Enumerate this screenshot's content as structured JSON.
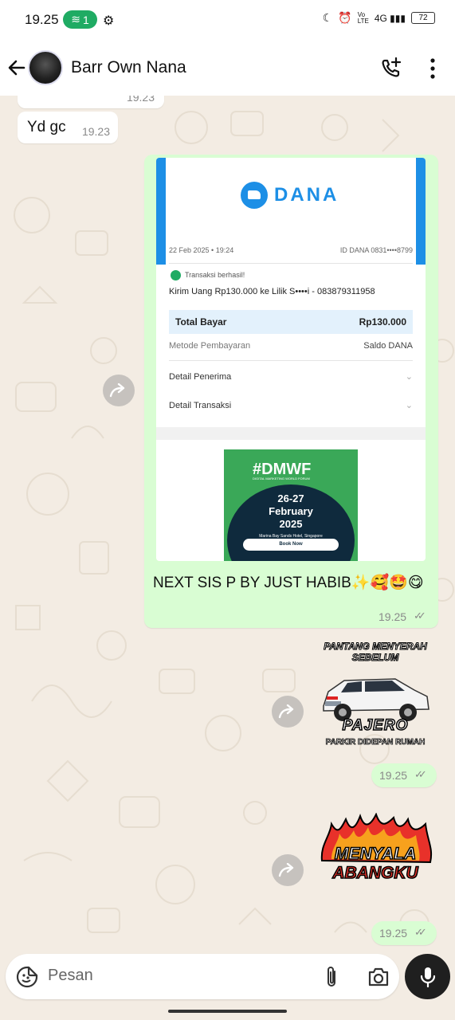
{
  "status_bar": {
    "time": "19.25",
    "hotspot_count": "1",
    "battery": "72"
  },
  "header": {
    "contact_name": "Barr Own Nana"
  },
  "messages": {
    "partial_time": "19.23",
    "incoming_text": "Yd gc",
    "incoming_time": "19.23",
    "receipt_caption": "NEXT SIS P BY JUST HABIB✨🥰🤩😋",
    "receipt_time": "19.25",
    "sticker1_time": "19.25",
    "sticker2_time": "19.25"
  },
  "receipt": {
    "brand": "DANA",
    "date": "22 Feb 2025 • 19:24",
    "id": "ID DANA 0831••••8799",
    "status": "Transaksi berhasil!",
    "description": "Kirim Uang Rp130.000 ke Lilik S••••i - 083879311958",
    "total_label": "Total Bayar",
    "total_value": "Rp130.000",
    "method_label": "Metode Pembayaran",
    "method_value": "Saldo DANA",
    "detail_recipient": "Detail Penerima",
    "detail_transaction": "Detail Transaksi"
  },
  "ad": {
    "title": "#DMWF",
    "subtitle": "DIGITAL MARKETING WORLD FORUM",
    "dates": "26-27",
    "month": "February",
    "year": "2025",
    "venue": "Marina Bay Sands Hotel, Singapore",
    "button": "Book Now"
  },
  "sticker1": {
    "top_text": "PANTANG MENYERAH SEBELUM",
    "brand": "PAJERO",
    "bottom_text": "PARKIR DIDEPAN RUMAH"
  },
  "sticker2": {
    "line1": "MENYALA",
    "line2": "ABANGKU"
  },
  "input": {
    "placeholder": "Pesan"
  },
  "colors": {
    "accent_green": "#1fab63",
    "outgoing_bubble": "#d9fdd3",
    "dana_blue": "#1d8fe6",
    "chat_background": "#f3ece3"
  },
  "icons": [
    "back-arrow-icon",
    "add-call-icon",
    "more-vert-icon",
    "forward-icon",
    "double-check-icon",
    "sticker-emoji-icon",
    "attach-clip-icon",
    "camera-icon",
    "mic-icon"
  ]
}
